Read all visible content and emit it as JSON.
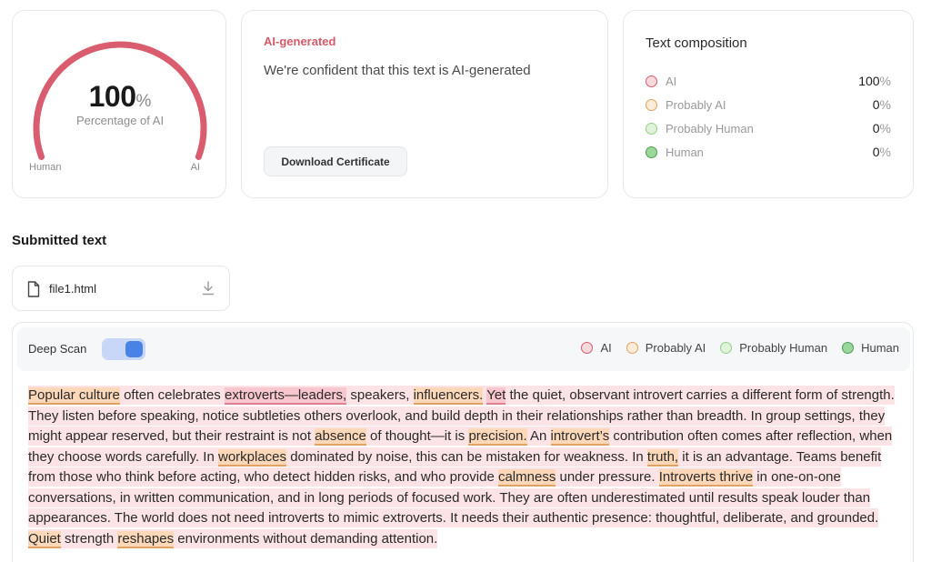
{
  "gauge": {
    "value": "100",
    "unit": "%",
    "caption": "Percentage of AI",
    "left_label": "Human",
    "right_label": "AI",
    "fraction": 1.0,
    "color": "#d95d6e"
  },
  "verdict": {
    "title": "AI-generated",
    "text": "We're confident that this text is AI-generated",
    "download_label": "Download Certificate"
  },
  "composition": {
    "title": "Text composition",
    "items": [
      {
        "label": "AI",
        "value": "100",
        "unit": "%",
        "color": "#f9d9dc",
        "border": "#d95d6e"
      },
      {
        "label": "Probably AI",
        "value": "0",
        "unit": "%",
        "color": "#fdecd8",
        "border": "#e0a25f"
      },
      {
        "label": "Probably Human",
        "value": "0",
        "unit": "%",
        "color": "#def3d9",
        "border": "#95cf87"
      },
      {
        "label": "Human",
        "value": "0",
        "unit": "%",
        "color": "#9ad79a",
        "border": "#4f9e55"
      }
    ]
  },
  "submitted": {
    "title": "Submitted text",
    "file_name": "file1.html",
    "file_icon": "document-icon",
    "download_icon": "download-icon"
  },
  "scan": {
    "label": "Deep Scan",
    "enabled": true,
    "legend": [
      {
        "label": "AI",
        "color": "#f9d9dc",
        "border": "#d95d6e"
      },
      {
        "label": "Probably AI",
        "color": "#fdecd8",
        "border": "#e0a25f"
      },
      {
        "label": "Probably Human",
        "color": "#def3d9",
        "border": "#95cf87"
      },
      {
        "label": "Human",
        "color": "#9ad79a",
        "border": "#4f9e55"
      }
    ],
    "segments": [
      {
        "t": "Popular culture",
        "h": "pai"
      },
      {
        "t": " often celebrates "
      },
      {
        "t": "extroverts—leaders,",
        "h": "ai"
      },
      {
        "t": " speakers, "
      },
      {
        "t": "influencers.",
        "h": "pai"
      },
      {
        "t": "  "
      },
      {
        "t": "Yet",
        "h": "ai"
      },
      {
        "t": " the quiet, observant introvert carries a different form of strength.  They listen before speaking, notice subtleties others overlook, and build depth in their relationships rather than breadth.  In group settings, they might appear reserved, but their restraint is not "
      },
      {
        "t": "absence",
        "h": "pai"
      },
      {
        "t": " of thought—it is "
      },
      {
        "t": "precision.",
        "h": "pai"
      },
      {
        "t": "  An "
      },
      {
        "t": "introvert’s",
        "h": "pai"
      },
      {
        "t": " contribution often comes after reflection, when they choose words carefully.  In "
      },
      {
        "t": "workplaces",
        "h": "pai"
      },
      {
        "t": " dominated by noise, this can be mistaken for weakness.  In "
      },
      {
        "t": "truth,",
        "h": "pai"
      },
      {
        "t": " it is an advantage.  Teams benefit from those who think before acting, who detect hidden risks, and who provide "
      },
      {
        "t": "calmness",
        "h": "pai"
      },
      {
        "t": " under pressure.  "
      },
      {
        "t": "Introverts thrive",
        "h": "pai"
      },
      {
        "t": " in one-on-one conversations, in written communication, and in long periods of focused work.  They are often underestimated until results speak louder than appearances.  The world does not need introverts to mimic extroverts.  It needs their authentic presence: thoughtful, deliberate, and grounded.  "
      },
      {
        "t": "Quiet",
        "h": "pai"
      },
      {
        "t": " strength "
      },
      {
        "t": "reshapes",
        "h": "pai"
      },
      {
        "t": " environments without demanding attention."
      }
    ]
  }
}
